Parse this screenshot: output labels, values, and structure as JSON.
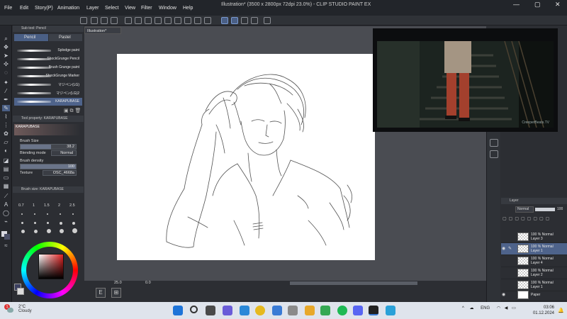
{
  "menubar": {
    "items": [
      "File",
      "Edit",
      "Story(P)",
      "Animation",
      "Layer",
      "Select",
      "View",
      "Filter",
      "Window",
      "Help"
    ],
    "title": "Illustration* (3500 x 2800px 72dpi 23.0%) - CLIP STUDIO PAINT EX",
    "controls": [
      "—",
      "▢",
      "✕"
    ]
  },
  "document_tab": "Illustration*",
  "subtool": {
    "header": "Sub tool: Pencil",
    "tabs": [
      "Pencil",
      "Pastel"
    ],
    "brushes": [
      "Splodge paint",
      "ShockGrunge Pencil",
      "Brush Grunge paint",
      "ShockGrunge Marker",
      "マジペン(LG)",
      "マジペン(LG)2",
      "KARAPUBASE"
    ]
  },
  "tool_property": {
    "header": "Tool property: KARAPUBASE",
    "brush_name": "KARAPUBASE",
    "brush_size_label": "Brush Size",
    "brush_size_value": "38.2",
    "brush_size_fraction": 0.55,
    "blending_label": "Blending mode",
    "blending_value": "Normal",
    "density_label": "Brush density",
    "density_value": "100",
    "density_fraction": 1.0,
    "texture_label": "Texture",
    "texture_value": "OSC_4668a"
  },
  "brush_size": {
    "header": "Brush size: KARAPUBASE",
    "values": [
      "0.7",
      "1",
      "1.5",
      "2",
      "2.5"
    ]
  },
  "canvas_controls": {
    "zoom": "25.0",
    "rotation": "0.0"
  },
  "video": {
    "watermark": "CreeperBeats.TV"
  },
  "layer_panel": {
    "header": "Layer",
    "blend": "Normal",
    "opacity": "100",
    "layers": [
      {
        "opacity": "100 %",
        "mode": "Normal",
        "name": "Layer 3",
        "selected": false
      },
      {
        "opacity": "100 %",
        "mode": "Normal",
        "name": "Layer 1",
        "selected": true
      },
      {
        "opacity": "100 %",
        "mode": "Normal",
        "name": "Layer 4",
        "selected": false
      },
      {
        "opacity": "100 %",
        "mode": "Normal",
        "name": "Layer 2",
        "selected": false
      },
      {
        "opacity": "100 %",
        "mode": "Normal",
        "name": "Layer 1",
        "selected": false
      },
      {
        "opacity": "",
        "mode": "",
        "name": "Paper",
        "selected": false
      }
    ]
  },
  "taskbar": {
    "weather_temp": "2°C",
    "weather_desc": "Cloudy",
    "notification_count": "1",
    "lang": "ENG",
    "time": "03:06",
    "date": "01.12.2024"
  },
  "colors": {
    "accent": "#4e638b",
    "panel": "#2c2e33"
  }
}
